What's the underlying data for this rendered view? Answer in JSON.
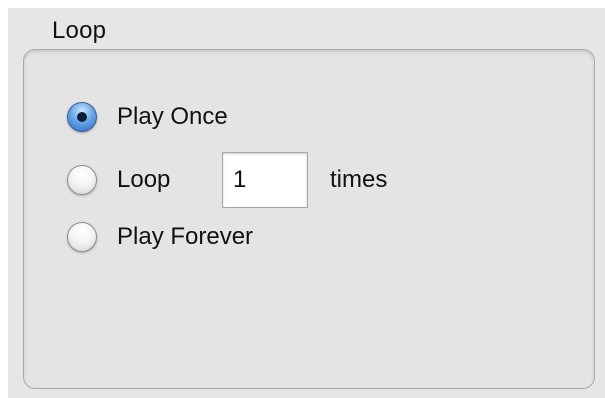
{
  "loop_group": {
    "title": "Loop",
    "options": {
      "play_once": {
        "label": "Play Once",
        "selected": true
      },
      "loop": {
        "label": "Loop",
        "selected": false
      },
      "play_forever": {
        "label": "Play Forever",
        "selected": false
      }
    },
    "loop_count": {
      "value": "1",
      "suffix": "times"
    }
  },
  "colors": {
    "panel_bg": "#e6e6e6",
    "radio_selected": "#2a67c3"
  }
}
